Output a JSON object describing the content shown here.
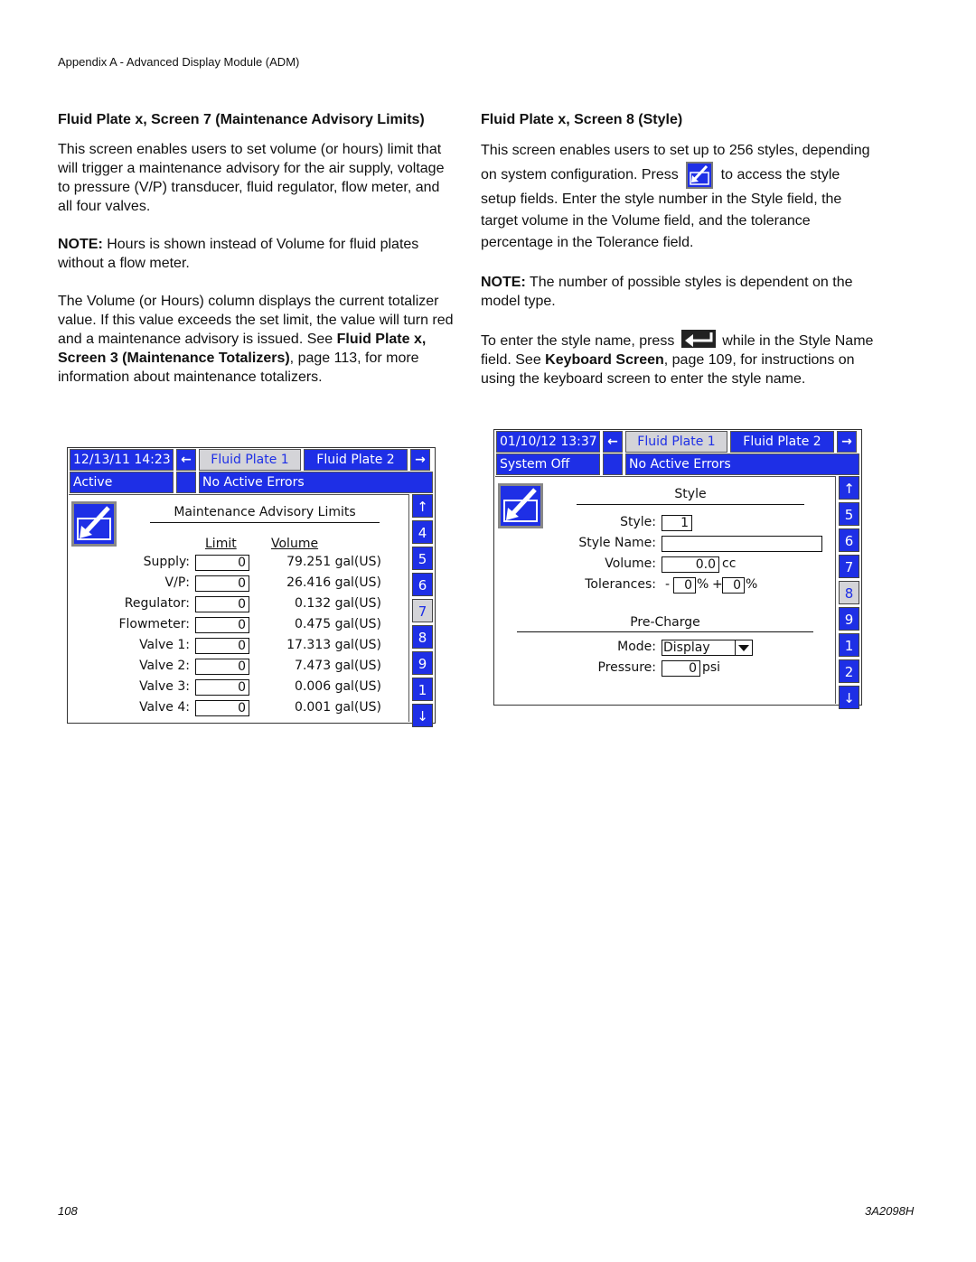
{
  "page": {
    "header": "Appendix A - Advanced Display Module (ADM)",
    "page_number": "108",
    "doc_id": "3A2098H"
  },
  "left": {
    "heading": "Fluid Plate x, Screen 7 (Maintenance Advisory Limits)",
    "p1": "This screen enables users to set volume (or hours) limit that will trigger a maintenance advisory for the air supply, voltage to pressure (V/P) transducer, fluid regulator, flow meter, and all four valves.",
    "note_label": "NOTE:",
    "note_text": " Hours is shown instead of Volume for fluid plates without a flow meter.",
    "p3a": "The Volume (or Hours) column displays the current totalizer value. If this value exceeds the set limit, the value will turn red and a maintenance advisory is issued. See ",
    "p3_bold": "Fluid Plate x, Screen 3 (Maintenance Totalizers)",
    "p3b": ", page 113, for more information about maintenance totalizers."
  },
  "right": {
    "heading": "Fluid Plate x, Screen 8 (Style)",
    "p1a": "This screen enables users to set up to 256 styles, depending on system configuration. Press ",
    "p1b": " to access the style setup fields. Enter the style number in the Style field, the target volume in the Volume field, and the tolerance percentage in the Tolerance field.",
    "note_label": "NOTE:",
    "note_text": " The number of possible styles is dependent on the model type.",
    "p3a": "To enter the style name, press ",
    "p3b": " while in the Style Name field. See ",
    "p3_bold": "Keyboard Screen",
    "p3c": ", page 109, for instructions on using the keyboard screen to enter the style name."
  },
  "screen7": {
    "datetime": "12/13/11 14:23",
    "tab_left_arrow": "←",
    "tab1": "Fluid Plate 1",
    "tab2": "Fluid Plate 2",
    "tab_right_arrow": "→",
    "status": "Active",
    "errors": "No Active Errors",
    "title": "Maintenance Advisory Limits",
    "col_limit": "Limit",
    "col_volume": "Volume",
    "rows": [
      {
        "label": "Supply:",
        "limit": "0",
        "volume": "79.251 gal(US)"
      },
      {
        "label": "V/P:",
        "limit": "0",
        "volume": "26.416 gal(US)"
      },
      {
        "label": "Regulator:",
        "limit": "0",
        "volume": "0.132 gal(US)"
      },
      {
        "label": "Flowmeter:",
        "limit": "0",
        "volume": "0.475 gal(US)"
      },
      {
        "label": "Valve 1:",
        "limit": "0",
        "volume": "17.313 gal(US)"
      },
      {
        "label": "Valve 2:",
        "limit": "0",
        "volume": "7.473 gal(US)"
      },
      {
        "label": "Valve 3:",
        "limit": "0",
        "volume": "0.006 gal(US)"
      },
      {
        "label": "Valve 4:",
        "limit": "0",
        "volume": "0.001 gal(US)"
      }
    ],
    "sidebar": [
      "↑",
      "4",
      "5",
      "6",
      "7",
      "8",
      "9",
      "1",
      "↓"
    ],
    "selected_screen": "7"
  },
  "screen8": {
    "datetime": "01/10/12 13:37",
    "tab_left_arrow": "←",
    "tab1": "Fluid Plate 1",
    "tab2": "Fluid Plate 2",
    "tab_right_arrow": "→",
    "status": "System Off",
    "errors": "No Active Errors",
    "title": "Style",
    "style_label": "Style:",
    "style_value": "1",
    "style_name_label": "Style Name:",
    "style_name_value": "",
    "volume_label": "Volume:",
    "volume_value": "0.0",
    "volume_unit": "cc",
    "tolerances_label": "Tolerances:",
    "tol_minus_sign": "-",
    "tol_minus_value": "0",
    "tol_plus_sign": "+",
    "tol_plus_value": "0",
    "percent": "%",
    "precharge_title": "Pre-Charge",
    "mode_label": "Mode:",
    "mode_value": "Display",
    "pressure_label": "Pressure:",
    "pressure_value": "0",
    "pressure_unit": "psi",
    "sidebar": [
      "↑",
      "5",
      "6",
      "7",
      "8",
      "9",
      "1",
      "2",
      "↓"
    ],
    "selected_screen": "8"
  },
  "colors": {
    "adm_blue": "#1e2fe6",
    "adm_selected": "#d4d4d8"
  }
}
